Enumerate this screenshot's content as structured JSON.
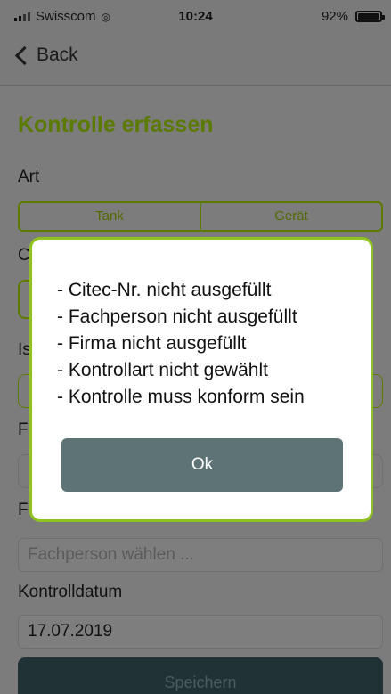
{
  "status_bar": {
    "carrier": "Swisscom",
    "time": "10:24",
    "battery": "92%"
  },
  "nav": {
    "back_label": "Back"
  },
  "page": {
    "title": "Kontrolle erfassen",
    "art_label": "Art",
    "art_options": [
      "Tank",
      "Gerät"
    ],
    "partial_labels": [
      "C",
      "Is",
      "F",
      "F"
    ],
    "fachperson_placeholder": "Fachperson wählen ...",
    "date_label": "Kontrolldatum",
    "date_value": "17.07.2019",
    "save_label": "Speichern"
  },
  "modal": {
    "messages": [
      "- Citec-Nr. nicht ausgefüllt",
      "- Fachperson nicht ausgefüllt",
      "- Firma nicht ausgefüllt",
      "- Kontrollart nicht gewählt",
      "- Kontrolle muss konform sein"
    ],
    "ok_label": "Ok"
  },
  "colors": {
    "accent": "#8dc21f",
    "title_green": "#5a7a00",
    "ok_button": "#5d7376",
    "save_button": "#213236"
  }
}
